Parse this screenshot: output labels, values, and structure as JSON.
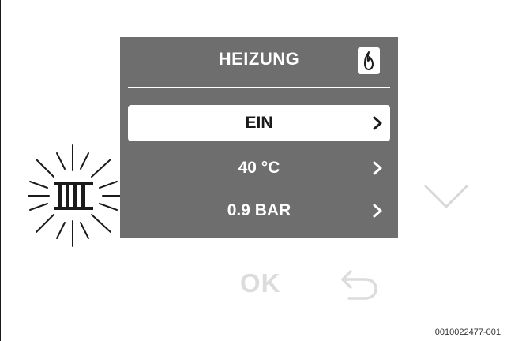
{
  "display": {
    "title": "HEIZUNG",
    "menu_items": [
      {
        "label": "EIN",
        "selected": true
      },
      {
        "label": "40 °C",
        "selected": false
      },
      {
        "label": "0.9 BAR",
        "selected": false
      }
    ]
  },
  "buttons": {
    "ok_label": "OK"
  },
  "icons": {
    "heating": "radiator-icon",
    "flame": "flame-icon",
    "down": "chevron-down-icon",
    "back": "back-arrow-icon",
    "row_arrow": "chevron-right-icon"
  },
  "colors": {
    "screen_background": "#6e6e6e",
    "inactive_button": "#dcdcdc"
  },
  "caption": "0010022477-001"
}
